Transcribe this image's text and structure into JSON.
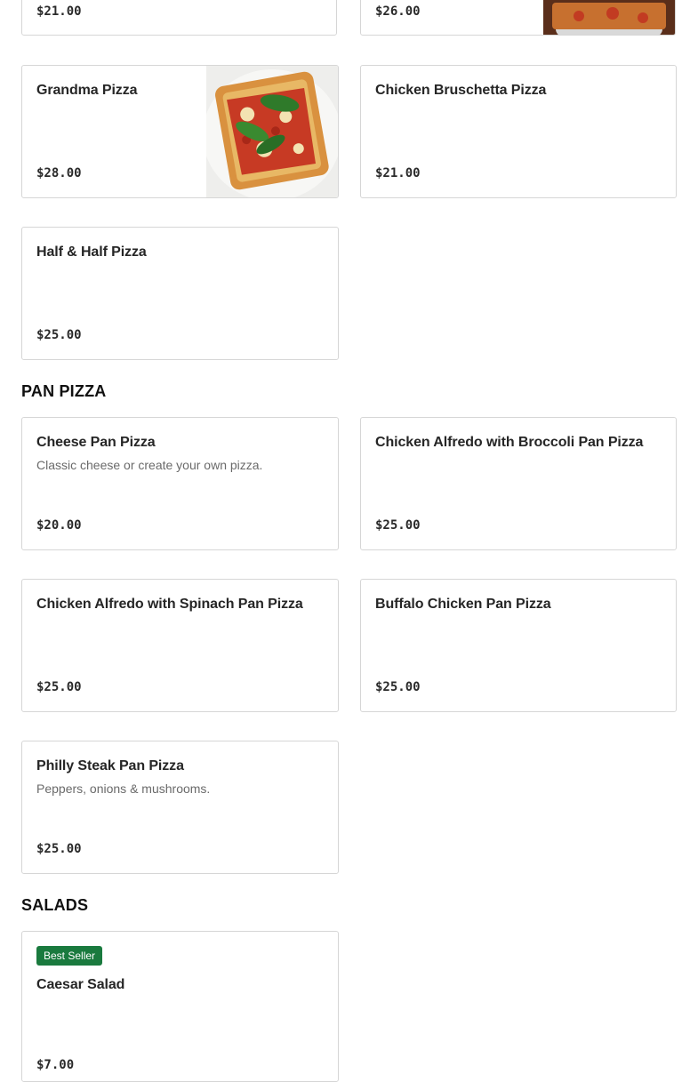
{
  "top_partial": {
    "left_price": "$21.00",
    "right_price": "$26.00"
  },
  "sections": {
    "pan_pizza_title": "PAN PIZZA",
    "salads_title": "SALADS"
  },
  "pizza_items": [
    {
      "name": "Grandma Pizza",
      "price": "$28.00",
      "image": "grandma-pizza-photo"
    },
    {
      "name": "Chicken Bruschetta Pizza",
      "price": "$21.00"
    },
    {
      "name": "Half & Half Pizza",
      "price": "$25.00"
    }
  ],
  "pan_pizza_items": [
    {
      "name": "Cheese Pan Pizza",
      "description": "Classic cheese or create your own pizza.",
      "price": "$20.00"
    },
    {
      "name": "Chicken Alfredo with Broccoli Pan Pizza",
      "price": "$25.00"
    },
    {
      "name": "Chicken Alfredo with Spinach Pan Pizza",
      "price": "$25.00"
    },
    {
      "name": "Buffalo Chicken Pan Pizza",
      "price": "$25.00"
    },
    {
      "name": "Philly Steak Pan Pizza",
      "description": "Peppers, onions & mushrooms.",
      "price": "$25.00"
    }
  ],
  "salad_items": [
    {
      "badge": "Best Seller",
      "name": "Caesar Salad",
      "price": "$7.00"
    }
  ],
  "colors": {
    "badge_bg": "#1a7a3e",
    "card_border": "#d6d6d6"
  }
}
